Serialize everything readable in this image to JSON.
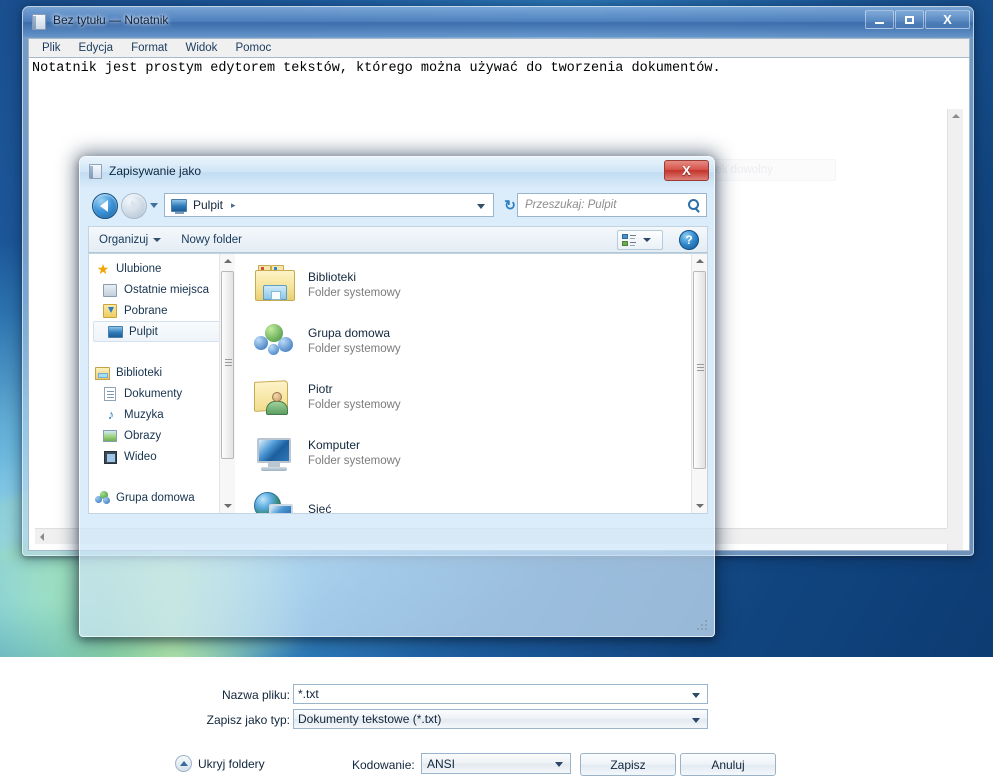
{
  "notepad": {
    "title": "Bez tytułu — Notatnik",
    "title_icon": "notepad-icon",
    "window_controls": {
      "minimize": "minimize-icon",
      "maximize": "maximize-icon",
      "close": "X"
    },
    "menu": [
      "Plik",
      "Edycja",
      "Format",
      "Widok",
      "Pomoc"
    ],
    "document_text": "Notatnik jest prostym edytorem tekstów, którego można używać do tworzenia dokumentów.",
    "ghost_overlay": "Wycinek dowolny"
  },
  "dialog": {
    "title": "Zapisywanie jako",
    "title_icon": "notepad-icon",
    "close_label": "X",
    "address": {
      "back_icon": "back-arrow-icon",
      "forward_icon": "forward-arrow-icon",
      "dropdown_icon": "chevron-down-icon",
      "location_icon": "desktop-icon",
      "location": "Pulpit",
      "separator": "▸",
      "refresh_icon": "refresh-icon",
      "refresh_glyph": "↻"
    },
    "search": {
      "placeholder": "Przeszukaj: Pulpit",
      "icon": "search-icon"
    },
    "toolbar": {
      "organize": "Organizuj",
      "new_folder": "Nowy folder",
      "view_icon": "view-mode-icon",
      "help_icon": "help-icon",
      "help_glyph": "?"
    },
    "nav_pane": [
      {
        "label": "Ulubione",
        "icon": "star-icon",
        "type": "header",
        "selected": false
      },
      {
        "label": "Ostatnie miejsca",
        "icon": "recent-icon",
        "type": "child",
        "selected": false
      },
      {
        "label": "Pobrane",
        "icon": "downloads-icon",
        "type": "child",
        "selected": false
      },
      {
        "label": "Pulpit",
        "icon": "desktop-icon",
        "type": "child",
        "selected": true
      },
      {
        "label": "Biblioteki",
        "icon": "libraries-icon",
        "type": "header",
        "selected": false
      },
      {
        "label": "Dokumenty",
        "icon": "documents-icon",
        "type": "child",
        "selected": false
      },
      {
        "label": "Muzyka",
        "icon": "music-icon",
        "type": "child",
        "selected": false
      },
      {
        "label": "Obrazy",
        "icon": "pictures-icon",
        "type": "child",
        "selected": false
      },
      {
        "label": "Wideo",
        "icon": "video-icon",
        "type": "child",
        "selected": false
      },
      {
        "label": "Grupa domowa",
        "icon": "homegroup-icon",
        "type": "header",
        "selected": false
      }
    ],
    "file_list": [
      {
        "name": "Biblioteki",
        "subtitle": "Folder systemowy",
        "icon": "libraries-folder-icon"
      },
      {
        "name": "Grupa domowa",
        "subtitle": "Folder systemowy",
        "icon": "homegroup-icon"
      },
      {
        "name": "Piotr",
        "subtitle": "Folder systemowy",
        "icon": "user-folder-icon"
      },
      {
        "name": "Komputer",
        "subtitle": "Folder systemowy",
        "icon": "computer-icon"
      },
      {
        "name": "Sieć",
        "subtitle": "",
        "icon": "network-icon"
      }
    ],
    "form": {
      "filename_label": "Nazwa pliku:",
      "filename_value": "*.txt",
      "filetype_label": "Zapisz jako typ:",
      "filetype_value": "Dokumenty tekstowe (*.txt)",
      "encoding_label": "Kodowanie:",
      "encoding_value": "ANSI",
      "hide_folders_label": "Ukryj foldery",
      "hide_folders_icon": "collapse-up-icon",
      "save_button": "Zapisz",
      "cancel_button": "Anuluj"
    }
  }
}
